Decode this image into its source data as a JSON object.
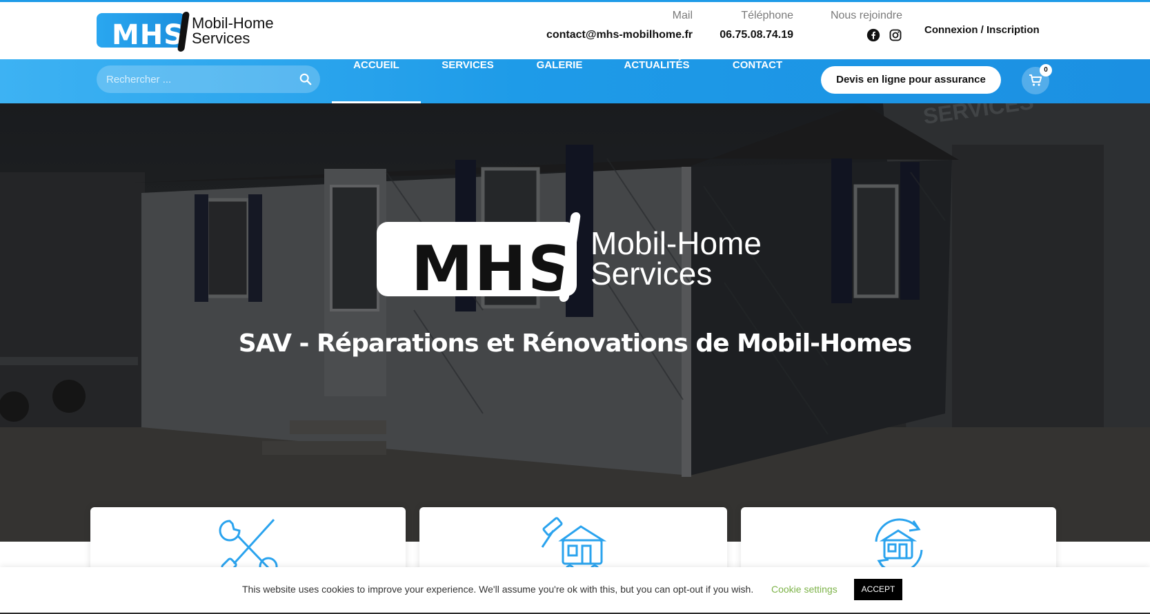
{
  "brand": {
    "logo_mark": "MHS",
    "logo_line1": "Mobil-Home",
    "logo_line2": "Services",
    "accent_color": "#1e9be8"
  },
  "header": {
    "mail": {
      "label": "Mail",
      "value": "contact@mhs-mobilhome.fr"
    },
    "phone": {
      "label": "Téléphone",
      "value": "06.75.08.74.19"
    },
    "social": {
      "label": "Nous rejoindre",
      "icons": [
        "facebook-icon",
        "instagram-icon"
      ]
    },
    "login": "Connexion / Inscription"
  },
  "nav": {
    "search_placeholder": "Rechercher ...",
    "items": [
      {
        "label": "ACCUEIL",
        "active": true
      },
      {
        "label": "SERVICES",
        "active": false
      },
      {
        "label": "GALERIE",
        "active": false
      },
      {
        "label": "ACTUALITÉS",
        "active": false
      },
      {
        "label": "CONTACT",
        "active": false
      }
    ],
    "cta": "Devis en ligne pour assurance",
    "cart_count": "0"
  },
  "hero": {
    "logo_mark": "MHS",
    "logo_line1": "Mobil-Home",
    "logo_line2": "Services",
    "title": "SAV - Réparations et Rénovations de Mobil-Homes",
    "background_text": "SERVICES"
  },
  "cards": [
    {
      "icon": "tools-icon"
    },
    {
      "icon": "hammer-house-icon"
    },
    {
      "icon": "renovation-cycle-icon"
    }
  ],
  "cookie": {
    "text": "This website uses cookies to improve your experience. We'll assume you're ok with this, but you can opt-out if you wish.",
    "settings": "Cookie settings",
    "accept": "ACCEPT"
  }
}
